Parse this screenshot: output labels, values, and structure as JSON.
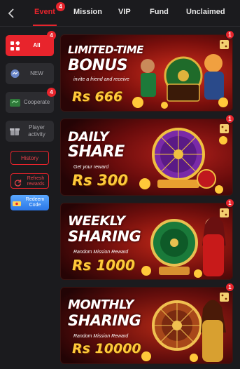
{
  "tabs": [
    {
      "label": "Event",
      "badge": "4",
      "active": true
    },
    {
      "label": "Mission"
    },
    {
      "label": "VIP"
    },
    {
      "label": "Fund"
    },
    {
      "label": "Unclaimed"
    }
  ],
  "sidebar": {
    "items": [
      {
        "label": "All",
        "badge": "4",
        "icon": "grid-icon",
        "active": true
      },
      {
        "label": "NEW",
        "icon": "chat-bubble-icon"
      },
      {
        "label": "Cooperate",
        "badge": "4",
        "icon": "handshake-icon"
      },
      {
        "label": "Player activity",
        "icon": "gift-icon"
      }
    ],
    "history_label": "History",
    "refresh_label": "Refresh rewards",
    "redeem_label": "Redeem Code"
  },
  "banners": [
    {
      "title1": "LIMITED-TIME",
      "title2": "BONUS",
      "subtitle": "invite a friend and receive",
      "prize": "Rs 666",
      "badge": "1"
    },
    {
      "title1": "DAILY",
      "title2": "SHARE",
      "subtitle": "Get your reward",
      "prize": "Rs 300",
      "badge": "1"
    },
    {
      "title1": "WEEKLY",
      "title2": "SHARING",
      "subtitle": "Random Mission Reward",
      "prize": "Rs 1000",
      "badge": "1"
    },
    {
      "title1": "MONTHLY",
      "title2": "SHARING",
      "subtitle": "Random Mission Reward",
      "prize": "Rs 10000",
      "badge": "1"
    }
  ],
  "colors": {
    "accent": "#e8242c",
    "background": "#1b1b1e",
    "gold": "#ffc93a"
  }
}
